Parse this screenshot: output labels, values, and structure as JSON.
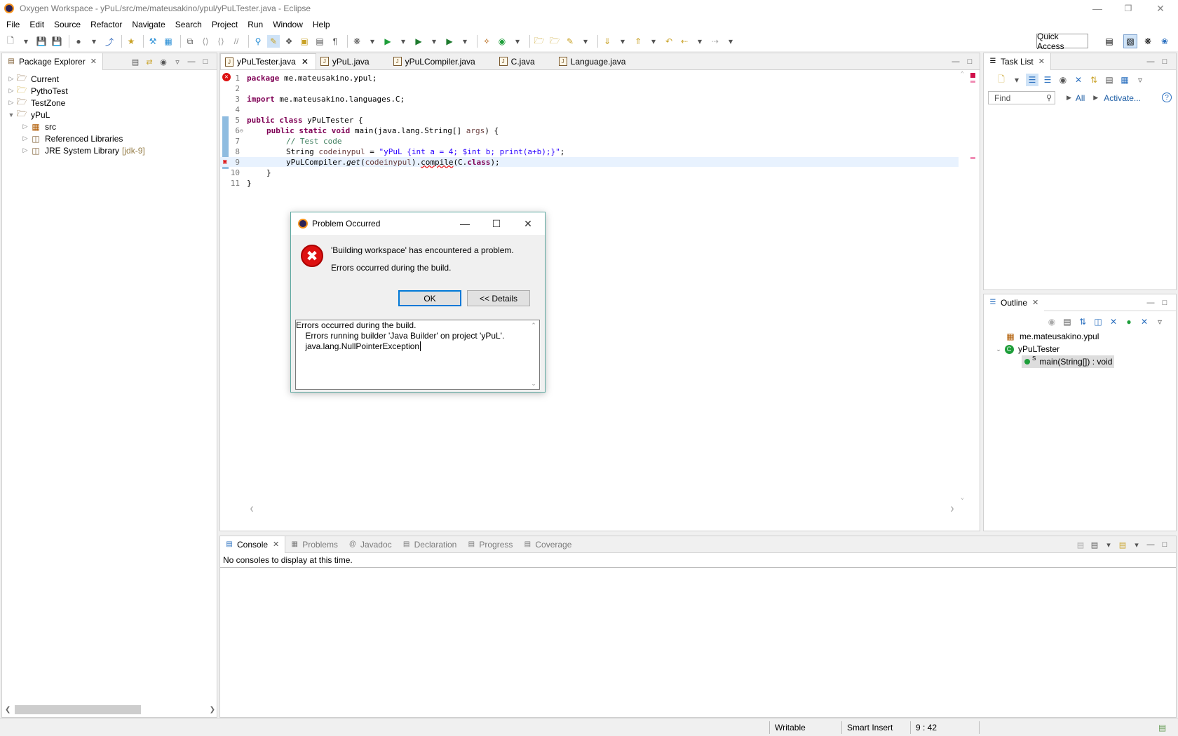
{
  "window": {
    "title": "Oxygen Workspace - yPuL/src/me/mateusakino/ypul/yPuLTester.java - Eclipse"
  },
  "menu": [
    "File",
    "Edit",
    "Source",
    "Refactor",
    "Navigate",
    "Search",
    "Project",
    "Run",
    "Window",
    "Help"
  ],
  "toolbar": {
    "quick_access": "Quick Access"
  },
  "package_explorer": {
    "tab": "Package Explorer",
    "items": [
      {
        "label": "Current",
        "extra": ""
      },
      {
        "label": "PythoTest",
        "extra": ""
      },
      {
        "label": "TestZone",
        "extra": ""
      },
      {
        "label": "yPuL",
        "extra": ""
      },
      {
        "label": "src",
        "extra": ""
      },
      {
        "label": "Referenced Libraries",
        "extra": ""
      },
      {
        "label": "JRE System Library",
        "extra": "[jdk-9]"
      }
    ]
  },
  "editor": {
    "tabs": [
      "yPuLTester.java",
      "yPuL.java",
      "yPuLCompiler.java",
      "C.java",
      "Language.java"
    ],
    "line_numbers": [
      "1",
      "2",
      "3",
      "4",
      "5",
      "6",
      "7",
      "8",
      "9",
      "10",
      "11"
    ],
    "code": {
      "l1_kw": "package",
      "l1_rest": " me.mateusakino.ypul;",
      "l3_kw": "import",
      "l3_rest": " me.mateusakino.languages.C;",
      "l5_kw": "public class",
      "l5_rest": " yPuLTester {",
      "l6_kw": "public static void",
      "l6_a": " main(java.lang.String[] ",
      "l6_var": "args",
      "l6_b": ") {",
      "l7_comment": "// Test code",
      "l8_a": "String ",
      "l8_var": "codeinypul",
      "l8_b": " = ",
      "l8_str": "\"yPuL {int a = 4; $int b; print(a+b);}\"",
      "l8_c": ";",
      "l9_a": "yPuLCompiler.",
      "l9_get": "get",
      "l9_b": "(",
      "l9_var": "codeinypul",
      "l9_c": ").",
      "l9_compile": "compile",
      "l9_d": "(C.",
      "l9_kw": "class",
      "l9_e": ");",
      "l10": "}",
      "l11": "}"
    }
  },
  "task_list": {
    "tab": "Task List",
    "find_placeholder": "Find",
    "all": "All",
    "activate": "Activate..."
  },
  "outline": {
    "tab": "Outline",
    "package": "me.mateusakino.ypul",
    "class": "yPuLTester",
    "method": "main(String[]) : void",
    "method_modifier": "S"
  },
  "console": {
    "tabs": [
      "Console",
      "Problems",
      "Javadoc",
      "Declaration",
      "Progress",
      "Coverage"
    ],
    "message": "No consoles to display at this time."
  },
  "status": {
    "writable": "Writable",
    "insert_mode": "Smart Insert",
    "position": "9 : 42"
  },
  "dialog": {
    "title": "Problem Occurred",
    "message": "'Building workspace' has encountered a problem.",
    "sub_message": "Errors occurred during the build.",
    "ok": "OK",
    "details": "<< Details",
    "details_lines": [
      "Errors occurred during the build.",
      "    Errors running builder 'Java Builder' on project 'yPuL'.",
      "    java.lang.NullPointerException"
    ]
  },
  "colors": {
    "keyword": "#7f0055",
    "comment": "#3f7f5f",
    "string": "#2a00ff",
    "variable": "#6a3e3e",
    "link": "#1f5fa6",
    "error": "#d11111"
  }
}
